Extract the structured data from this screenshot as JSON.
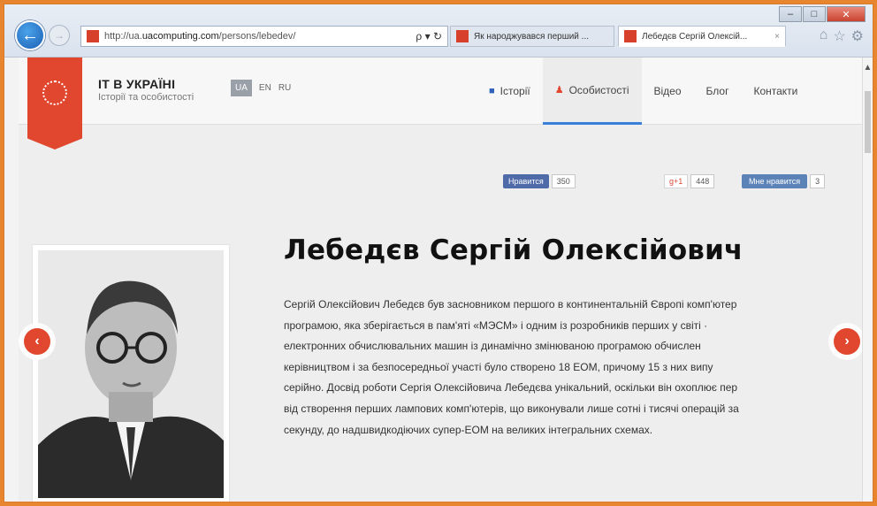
{
  "browser": {
    "url_prefix": "http://ua.",
    "url_domain": "uacomputing.com",
    "url_path": "/persons/lebedev/",
    "url_controls": "ρ ▾ ↻",
    "tabs": [
      {
        "label": "Як народжувався перший ..."
      },
      {
        "label": "Лебедєв Сергій Олексій...",
        "close": "×"
      }
    ]
  },
  "site": {
    "brand_title": "IT В УКРАЇНІ",
    "brand_subtitle": "Історії та особистості",
    "langs": [
      "UA",
      "EN",
      "RU"
    ],
    "nav": [
      "Історії",
      "Особистості",
      "Відео",
      "Блог",
      "Контакти"
    ]
  },
  "social": {
    "fb_label": "Нравится",
    "fb_count": "350",
    "gplus_label": "g+1",
    "gplus_count": "448",
    "vk_label": "Мне нравится"
  },
  "person": {
    "name": "Лебедєв Сергій Олексійович",
    "bio_lines": [
      "Сергій Олексійович Лебедєв був засновником першого в континентальній Європі комп'ютер",
      "програмою, яка зберігається в пам'яті «МЭСМ» і одним із розробників перших у світі ·",
      "електронних обчислювальних машин із динамічно змінюваною програмою обчислен",
      "керівництвом і за безпосередньої участі було створено 18 ЕОМ, причому 15 з них випу",
      "серійно. Досвід роботи Сергія Олексійовича Лебедєва унікальний, оскільки він охоплює пер",
      "від створення перших лампових комп'ютерів, що виконували лише сотні і тисячі операцій за",
      "секунду, до надшвидкодіючих супер-ЕОМ на великих інтегральних схемах."
    ]
  },
  "colors": {
    "accent": "#e1462e",
    "link_blue": "#3a7fd8"
  }
}
